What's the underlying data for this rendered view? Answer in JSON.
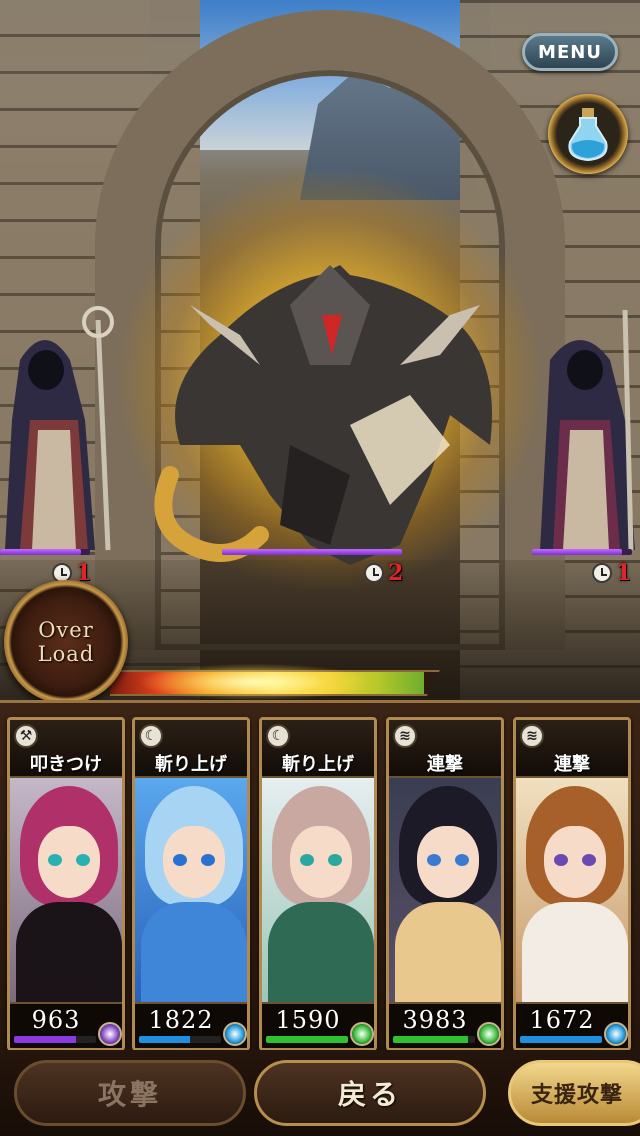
{
  "header": {
    "menu_label": "MENU",
    "potion_icon": "potion-icon"
  },
  "enemies": [
    {
      "id": "left-mage",
      "hp_fraction": 0.9,
      "turns": "1"
    },
    {
      "id": "dragon",
      "hp_fraction": 1.0,
      "turns": "2"
    },
    {
      "id": "right-mage",
      "hp_fraction": 0.9,
      "turns": "1"
    }
  ],
  "overload": {
    "line1": "Over",
    "line2": "Load",
    "gauge_fraction": 0.95
  },
  "party": [
    {
      "skill_icon": "hammer-icon",
      "skill_name": "叩きつけ",
      "attack": "963",
      "element": "dark",
      "element_color": "#8a4ec8",
      "bar_color": "#8a3ae0",
      "hp_fraction": 0.75
    },
    {
      "skill_icon": "crescent-slash-icon",
      "skill_name": "斬り上げ",
      "attack": "1822",
      "element": "water",
      "element_color": "#2aa0e0",
      "bar_color": "#1f8fe0",
      "hp_fraction": 0.62
    },
    {
      "skill_icon": "crescent-slash-icon",
      "skill_name": "斬り上げ",
      "attack": "1590",
      "element": "wind",
      "element_color": "#3cbf3c",
      "bar_color": "#2fc42f",
      "hp_fraction": 1.0
    },
    {
      "skill_icon": "multi-slash-icon",
      "skill_name": "連撃",
      "attack": "3983",
      "element": "wind",
      "element_color": "#3cbf3c",
      "bar_color": "#2fc42f",
      "hp_fraction": 0.92
    },
    {
      "skill_icon": "multi-slash-icon",
      "skill_name": "連撃",
      "attack": "1672",
      "element": "water",
      "element_color": "#2aa0e0",
      "bar_color": "#1f8fe0",
      "hp_fraction": 1.0
    }
  ],
  "commands": {
    "attack_label": "攻撃",
    "back_label": "戻る",
    "support_label": "支援攻撃"
  }
}
